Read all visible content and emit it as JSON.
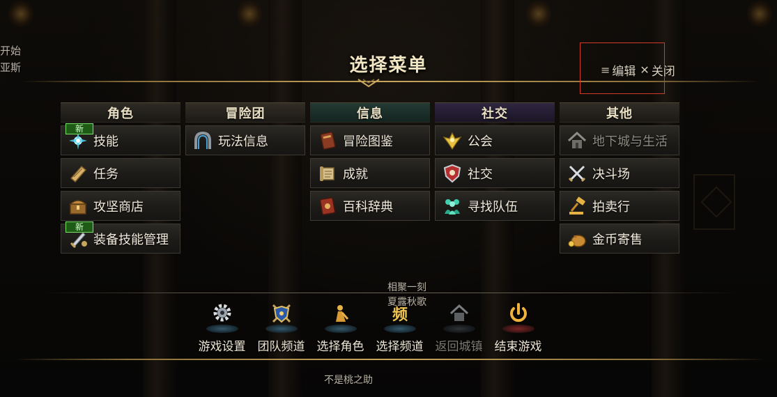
{
  "title": "选择菜单",
  "top_actions": {
    "edit_label": "编辑",
    "close_label": "关闭"
  },
  "background_text": {
    "left_top": "开始",
    "left_bottom": "亚斯",
    "center_1": "相聚一刻",
    "center_2": "夏露秋歌",
    "center_3": "不是桃之助"
  },
  "columns": [
    {
      "header": "角色",
      "items": [
        {
          "label": "技能",
          "icon": "skill-icon",
          "badge": "新",
          "enabled": true
        },
        {
          "label": "任务",
          "icon": "quest-scroll-icon",
          "badge": "",
          "enabled": true
        },
        {
          "label": "攻坚商店",
          "icon": "treasure-chest-icon",
          "badge": "",
          "enabled": true
        },
        {
          "label": "装备技能管理",
          "icon": "sword-equip-icon",
          "badge": "新",
          "enabled": true
        }
      ]
    },
    {
      "header": "冒险团",
      "items": [
        {
          "label": "玩法信息",
          "icon": "portal-icon",
          "badge": "",
          "enabled": true
        }
      ]
    },
    {
      "header": "信息",
      "items": [
        {
          "label": "冒险图鉴",
          "icon": "book-icon",
          "badge": "",
          "enabled": true
        },
        {
          "label": "成就",
          "icon": "scroll-icon",
          "badge": "",
          "enabled": true
        },
        {
          "label": "百科辞典",
          "icon": "encyclopedia-icon",
          "badge": "",
          "enabled": true
        }
      ]
    },
    {
      "header": "社交",
      "items": [
        {
          "label": "公会",
          "icon": "guild-emblem-icon",
          "badge": "",
          "enabled": true
        },
        {
          "label": "社交",
          "icon": "shield-social-icon",
          "badge": "",
          "enabled": true
        },
        {
          "label": "寻找队伍",
          "icon": "party-icon",
          "badge": "",
          "enabled": true
        }
      ]
    },
    {
      "header": "其他",
      "items": [
        {
          "label": "地下城与生活",
          "icon": "house-icon",
          "badge": "",
          "enabled": false
        },
        {
          "label": "决斗场",
          "icon": "crossed-swords-icon",
          "badge": "",
          "enabled": true
        },
        {
          "label": "拍卖行",
          "icon": "gavel-icon",
          "badge": "",
          "enabled": true
        },
        {
          "label": "金币寄售",
          "icon": "gold-bag-icon",
          "badge": "",
          "enabled": true
        }
      ]
    }
  ],
  "bottom_buttons": [
    {
      "label": "游戏设置",
      "icon": "gear-icon",
      "enabled": true
    },
    {
      "label": "团队频道",
      "icon": "team-shield-icon",
      "enabled": true
    },
    {
      "label": "选择角色",
      "icon": "character-icon",
      "enabled": true
    },
    {
      "label": "选择频道",
      "icon": "channel-icon",
      "enabled": true,
      "glyph": "频"
    },
    {
      "label": "返回城镇",
      "icon": "town-icon",
      "enabled": false
    },
    {
      "label": "结束游戏",
      "icon": "power-icon",
      "enabled": true
    }
  ],
  "colors": {
    "accent_gold": "#c8a65e",
    "highlight_red": "#d23a2a",
    "new_badge_green": "#1d5b16"
  }
}
